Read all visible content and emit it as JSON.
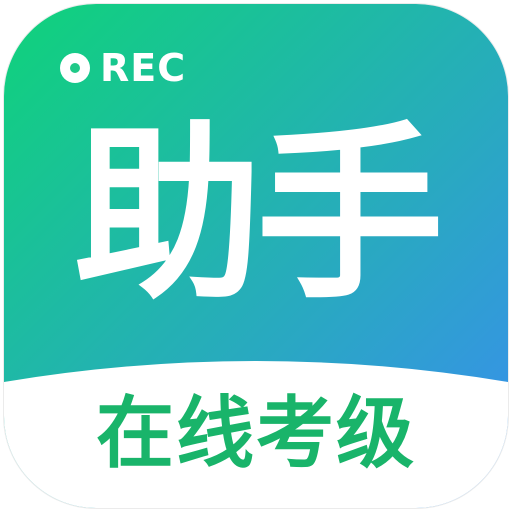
{
  "icon": {
    "badge": {
      "dot_icon": "record-dot-icon",
      "label": "REC"
    },
    "title": "助手",
    "subtitle": "在线考级",
    "colors": {
      "gradient_start": "#0fd37a",
      "gradient_end": "#3a8df0",
      "title_text": "#ffffff",
      "subtitle_text": "#19b46a",
      "bottom_panel": "#ffffff"
    }
  }
}
